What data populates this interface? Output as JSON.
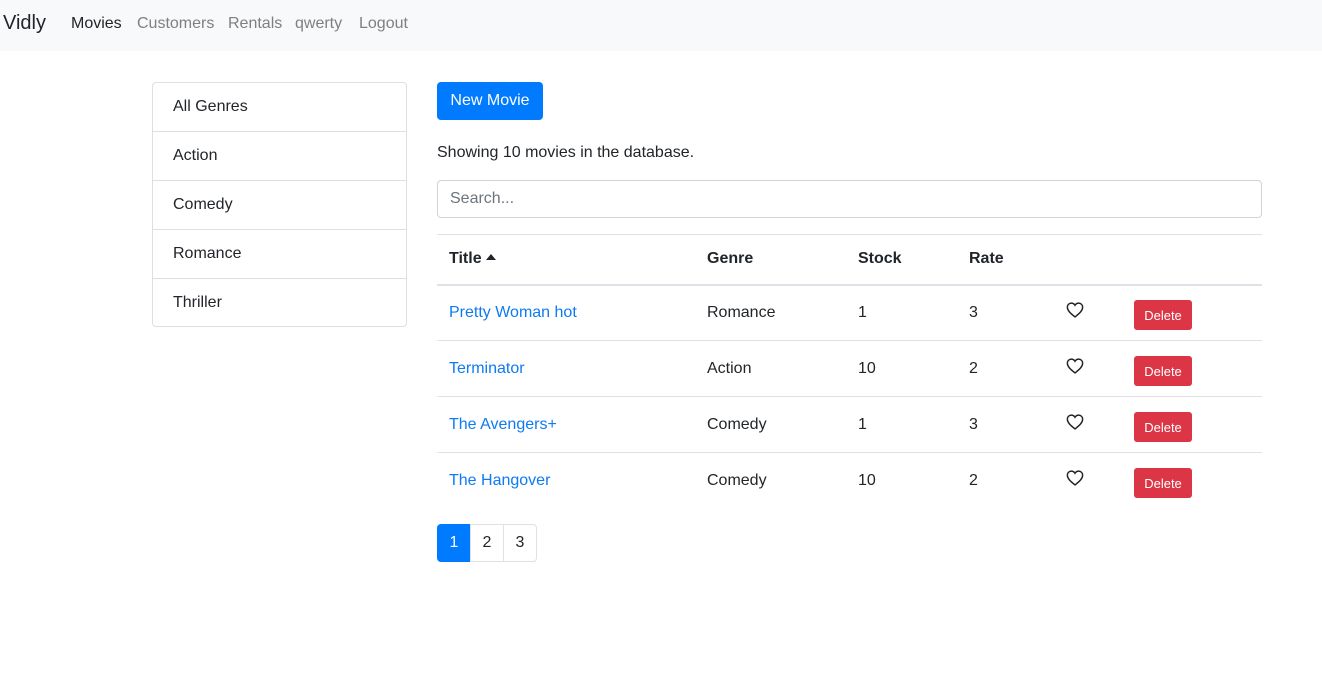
{
  "navbar": {
    "brand": "Vidly",
    "links": [
      {
        "label": "Movies",
        "active": true
      },
      {
        "label": "Customers",
        "active": false
      },
      {
        "label": "Rentals",
        "active": false
      },
      {
        "label": "qwerty",
        "active": false
      },
      {
        "label": "Logout",
        "active": false
      }
    ]
  },
  "genres": [
    "All Genres",
    "Action",
    "Comedy",
    "Romance",
    "Thriller"
  ],
  "main": {
    "new_movie_label": "New Movie",
    "count_text": "Showing 10 movies in the database.",
    "search_placeholder": "Search..."
  },
  "table": {
    "headers": {
      "title": "Title",
      "genre": "Genre",
      "stock": "Stock",
      "rate": "Rate"
    },
    "rows": [
      {
        "title": "Pretty Woman hot",
        "genre": "Romance",
        "stock": "1",
        "rate": "3",
        "delete_label": "Delete"
      },
      {
        "title": "Terminator",
        "genre": "Action",
        "stock": "10",
        "rate": "2",
        "delete_label": "Delete"
      },
      {
        "title": "The Avengers+",
        "genre": "Comedy",
        "stock": "1",
        "rate": "3",
        "delete_label": "Delete"
      },
      {
        "title": "The Hangover",
        "genre": "Comedy",
        "stock": "10",
        "rate": "2",
        "delete_label": "Delete"
      }
    ]
  },
  "pagination": {
    "pages": [
      "1",
      "2",
      "3"
    ],
    "current": "1"
  },
  "colors": {
    "primary": "#007bff",
    "danger": "#dc3545",
    "link": "#0d7bf2",
    "navbar_bg": "#f8f9fa"
  }
}
